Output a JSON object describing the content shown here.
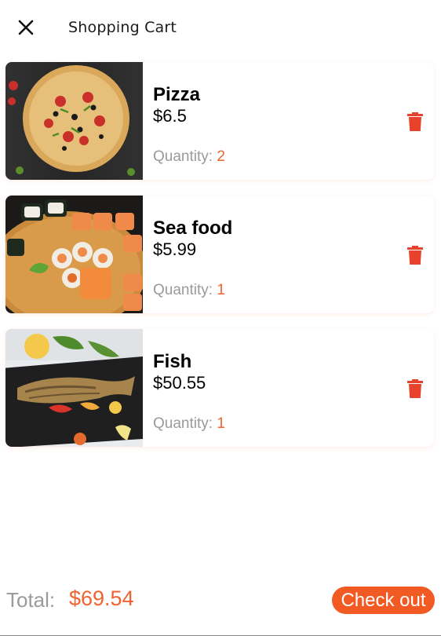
{
  "header": {
    "title": "Shopping Cart",
    "close_icon": "close-icon"
  },
  "cart": {
    "items": [
      {
        "name": "Pizza",
        "price": "$6.5",
        "quantity_label": "Quantity:",
        "quantity": "2",
        "image": "pizza-image",
        "delete_icon": "trash-icon"
      },
      {
        "name": "Sea food",
        "price": "$5.99",
        "quantity_label": "Quantity:",
        "quantity": "1",
        "image": "sushi-image",
        "delete_icon": "trash-icon"
      },
      {
        "name": "Fish",
        "price": "$50.55",
        "quantity_label": "Quantity:",
        "quantity": "1",
        "image": "grilled-fish-image",
        "delete_icon": "trash-icon"
      }
    ]
  },
  "footer": {
    "total_label": "Total:",
    "total_value": "$69.54",
    "checkout_label": "Check out"
  },
  "colors": {
    "accent": "#f25a24",
    "delete": "#e8412c",
    "muted_text": "#9a9a9a"
  }
}
